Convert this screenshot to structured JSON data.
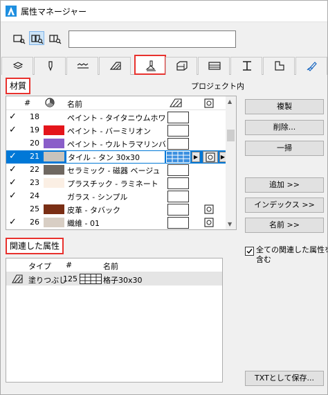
{
  "window": {
    "title": "属性マネージャー"
  },
  "filter": {
    "value": "",
    "placeholder": ""
  },
  "tabs": [
    {
      "icon": "layers-icon",
      "selected": false
    },
    {
      "icon": "pen-icon",
      "selected": false
    },
    {
      "icon": "line-type-icon",
      "selected": false
    },
    {
      "icon": "fill-icon",
      "selected": false
    },
    {
      "icon": "surface-paint-icon",
      "selected": true
    },
    {
      "icon": "building-material-icon",
      "selected": false
    },
    {
      "icon": "composite-icon",
      "selected": false
    },
    {
      "icon": "profile-icon",
      "selected": false
    },
    {
      "icon": "zone-category-icon",
      "selected": false
    },
    {
      "icon": "markup-pen-icon",
      "selected": false
    }
  ],
  "materials": {
    "section_label": "材質",
    "scope_label": "プロジェクト内",
    "columns": {
      "num": "#",
      "name": "名前"
    },
    "rows": [
      {
        "check": "✓",
        "num": "18",
        "color": "#ffffff",
        "name": "ペイント - タイタニウムホワイト",
        "has_file": false
      },
      {
        "check": "✓",
        "num": "19",
        "color": "#e4151b",
        "name": "ペイント - バーミリオン",
        "has_file": false
      },
      {
        "check": "",
        "num": "20",
        "color": "#8a5ec9",
        "name": "ペイント - ウルトラマリンバイ...",
        "has_file": false
      },
      {
        "check": "✓",
        "num": "21",
        "color": "#c8c3bc",
        "name": "タイル - タン 30x30",
        "has_file": true,
        "selected": true
      },
      {
        "check": "✓",
        "num": "22",
        "color": "#6f6861",
        "name": "セラミック - 磁器 ベージュ",
        "has_file": false
      },
      {
        "check": "✓",
        "num": "23",
        "color": "#fbefe4",
        "name": "プラスチック - ラミネート",
        "has_file": false
      },
      {
        "check": "✓",
        "num": "24",
        "color": "#ffffff",
        "name": "ガラス - シンプル",
        "has_file": false
      },
      {
        "check": "",
        "num": "25",
        "color": "#7a2e14",
        "name": "皮革 - タバック",
        "has_file": true
      },
      {
        "check": "✓",
        "num": "26",
        "color": "#d8cec4",
        "name": "織維 - 01",
        "has_file": true
      }
    ]
  },
  "buttons": {
    "duplicate": "複製",
    "delete": "削除...",
    "purge": "一掃",
    "append": "追加 >>",
    "index": "インデックス >>",
    "name": "名前 >>",
    "save_txt": "TXTとして保存..."
  },
  "related": {
    "section_label": "関連した属性",
    "columns": {
      "type": "タイプ",
      "num": "#",
      "name": "名前"
    },
    "rows": [
      {
        "type": "塗りつぶし",
        "num": "125",
        "name": "格子30x30"
      }
    ]
  },
  "include_all": {
    "label": "全ての関連した属性を含む",
    "checked": true
  },
  "colors": {
    "accent_red": "#e8312d",
    "selection_blue": "#0078d7"
  }
}
